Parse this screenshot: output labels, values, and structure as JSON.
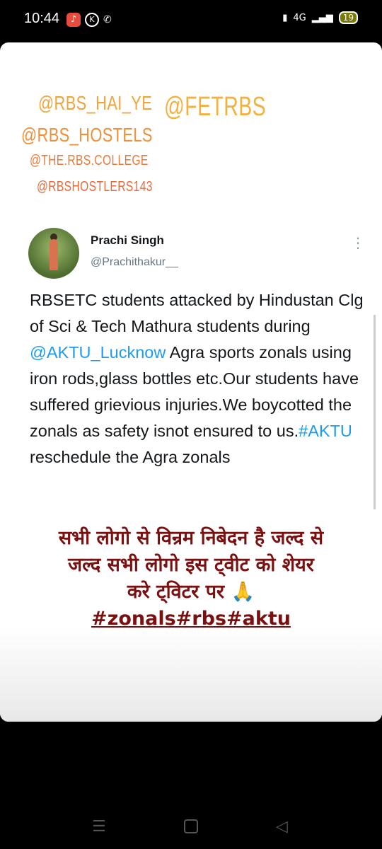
{
  "status_bar": {
    "time": "10:44",
    "app_icons": [
      "tiktok-icon",
      "k-icon",
      "whatsapp-icon"
    ],
    "k_label": "K",
    "network": "4G",
    "battery": "19"
  },
  "handles": [
    "@RBS_HAI_YE",
    "@FETRBS",
    "@RBS_HOSTELS",
    "@THE.RBS.COLLEGE",
    "@RBSHOSTLERS143"
  ],
  "tweet": {
    "name": "Prachi Singh",
    "username": "@Prachithakur__",
    "text_1": "RBSETC students attacked by Hindustan Clg of Sci & Tech Mathura students during ",
    "mention": "@AKTU_Lucknow",
    "text_2": " Agra sports zonals using iron rods,glass bottles etc.Our students have suffered grievious injuries.We boycotted the zonals as safety isnot ensured to us.",
    "hashtag": "#AKTU",
    "text_3": " reschedule the Agra zonals"
  },
  "overlay": {
    "line1": "सभी लोगो से विन्रम निबेदन है जल्द से",
    "line2": "जल्द सभी लोगो इस ट्वीट को शेयर",
    "line3": "करे ट्विटर पर 🙏",
    "tags": "#zonals#rbs#aktu"
  }
}
